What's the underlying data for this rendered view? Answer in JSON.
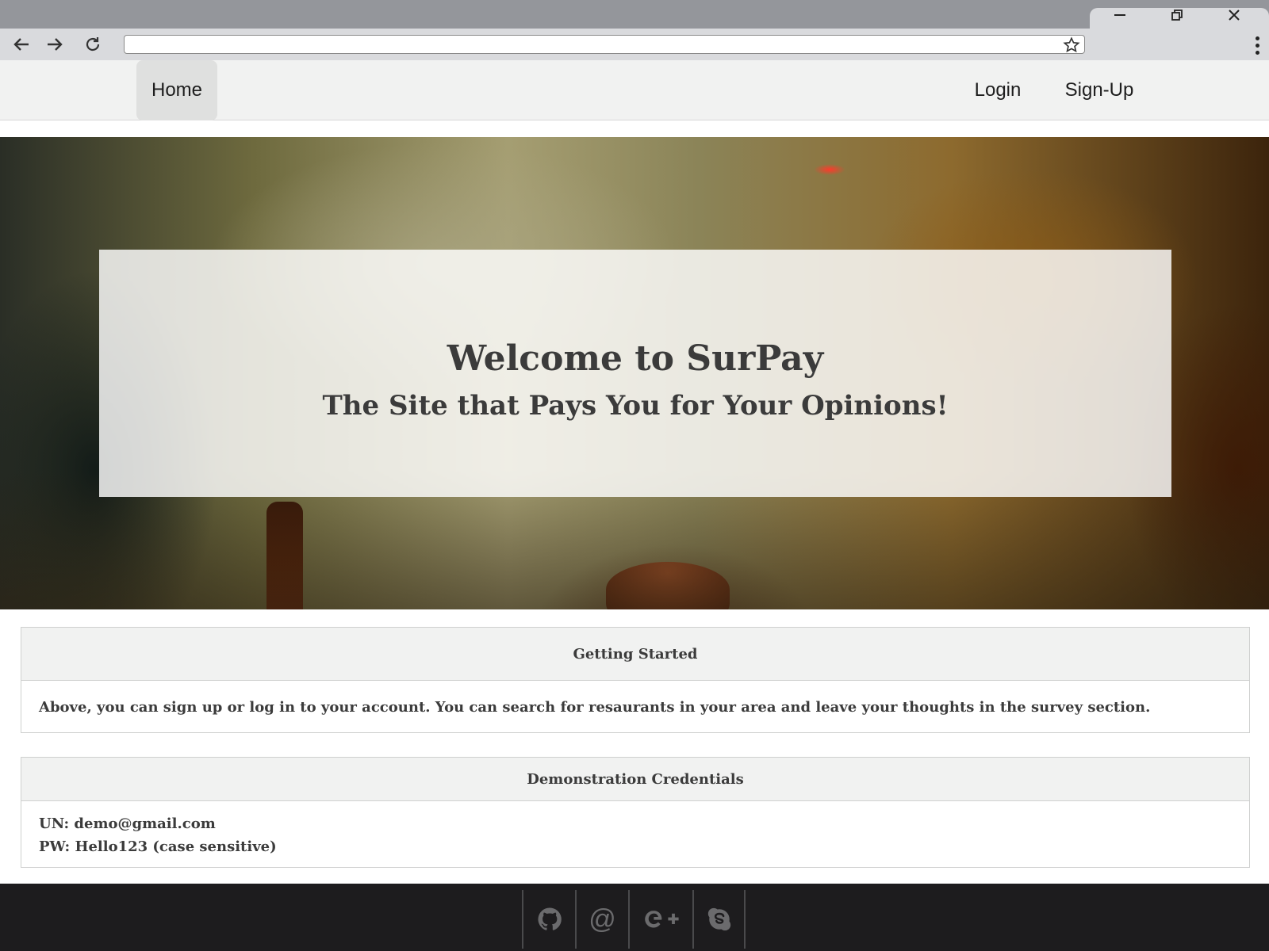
{
  "browser": {
    "url": "",
    "icons": [
      "back-arrow-icon",
      "forward-arrow-icon",
      "reload-icon",
      "bookmark-star-icon",
      "menu-dots-icon",
      "minimize-icon",
      "restore-icon",
      "close-icon"
    ]
  },
  "nav": {
    "home": "Home",
    "login": "Login",
    "signup": "Sign-Up"
  },
  "hero": {
    "title": "Welcome to SurPay",
    "subtitle": "The Site that Pays You for Your Opinions!"
  },
  "getting_started": {
    "heading": "Getting Started",
    "body": "Above, you can sign up or log in to your account. You can search for resaurants in your area and leave your thoughts in the survey section."
  },
  "demo_credentials": {
    "heading": "Demonstration Credentials",
    "username": "UN: demo@gmail.com",
    "password": "PW: Hello123 (case sensitive)"
  },
  "footer": {
    "email_symbol": "@",
    "icons": [
      "github-icon",
      "email-icon",
      "google-plus-icon",
      "skype-icon"
    ]
  },
  "colors": {
    "navbar_bg": "#f1f2f1",
    "text_dark": "#3b3b3b",
    "footer_bg": "#1d1c1e",
    "footer_icon": "#6b6b6d",
    "chrome_titlebar": "#94969b",
    "chrome_toolbar": "#d9dadd"
  }
}
